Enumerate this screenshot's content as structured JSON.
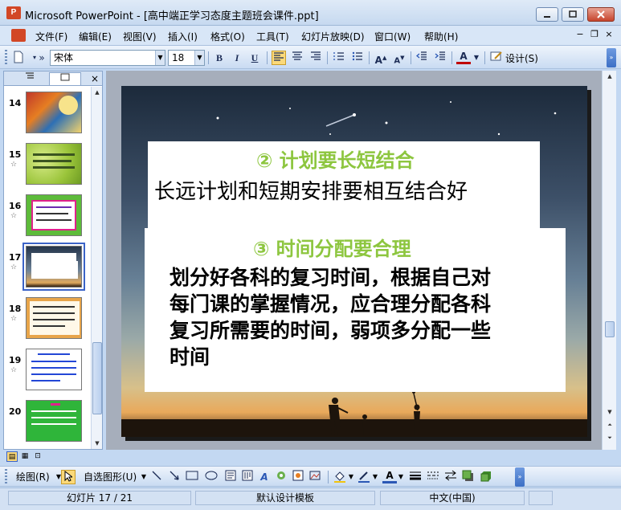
{
  "window": {
    "title": "Microsoft PowerPoint - [高中端正学习态度主题班会课件.ppt]",
    "app_icon_text": "P",
    "min_icon": "minimize-icon",
    "max_icon": "maximize-icon",
    "close_icon": "close-icon"
  },
  "menu": {
    "items": [
      "文件(F)",
      "编辑(E)",
      "视图(V)",
      "插入(I)",
      "格式(O)",
      "工具(T)",
      "幻灯片放映(D)",
      "窗口(W)",
      "帮助(H)"
    ],
    "mdi_min": "−",
    "mdi_restore": "❐",
    "mdi_close": "×"
  },
  "toolbar": {
    "font_name": "宋体",
    "font_size": "18",
    "bold": "B",
    "italic": "I",
    "underline": "U",
    "design_label": "设计(S)"
  },
  "panel": {
    "tab_outline_icon": "outline-icon",
    "tab_slides_icon": "slides-icon",
    "close": "×",
    "slides": [
      {
        "num": "14",
        "star": false
      },
      {
        "num": "15",
        "star": true
      },
      {
        "num": "16",
        "star": true
      },
      {
        "num": "17",
        "star": true,
        "selected": true
      },
      {
        "num": "18",
        "star": true
      },
      {
        "num": "19",
        "star": true
      },
      {
        "num": "20",
        "star": false
      }
    ]
  },
  "slide": {
    "heading1": "② 计划要长短结合",
    "body1": "长远计划和短期安排要相互结合好",
    "heading2": "③ 时间分配要合理",
    "body2": [
      "划分好各科的复习时间，根据自己对",
      "每门课的掌握情况，应合理分配各科",
      "复习所需要的时间，弱项多分配一些",
      "时间"
    ]
  },
  "drawbar": {
    "draw_label": "绘图(R)",
    "autoshapes_label": "自选图形(U)"
  },
  "status": {
    "slide_info": "幻灯片 17 / 21",
    "template": "默认设计模板",
    "language": "中文(中国)"
  },
  "colors": {
    "heading": "#8dc63f",
    "accent": "#3b63c7"
  }
}
